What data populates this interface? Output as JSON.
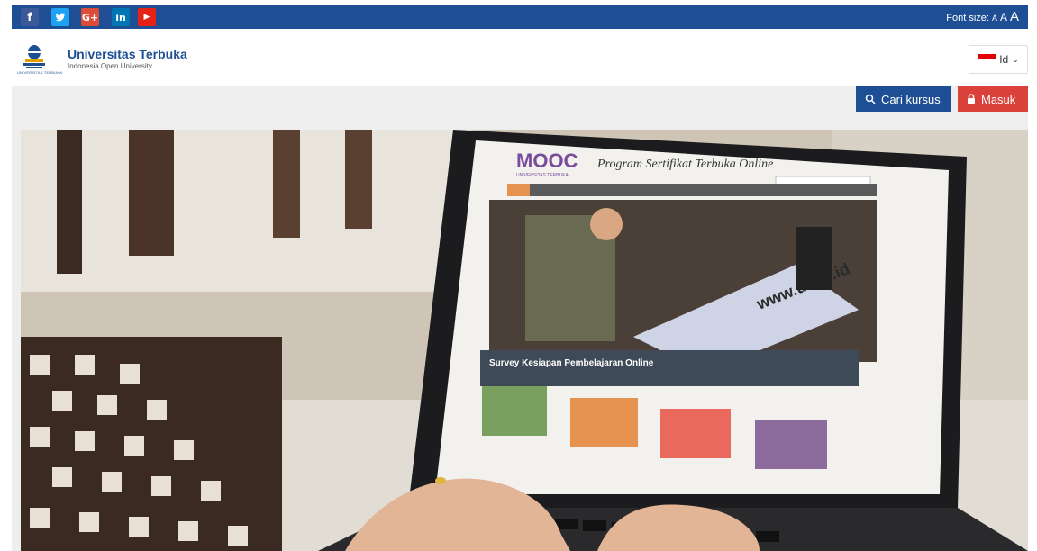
{
  "social": [
    {
      "name": "facebook",
      "glyph": "f",
      "color": "#3b5998"
    },
    {
      "name": "twitter",
      "glyph": "t",
      "color": "#1da1f2"
    },
    {
      "name": "google-plus",
      "glyph": "G+",
      "color": "#dd4b39"
    },
    {
      "name": "linkedin",
      "glyph": "in",
      "color": "#0077b5"
    },
    {
      "name": "youtube",
      "glyph": "▶",
      "color": "#e62117"
    }
  ],
  "fontsize": {
    "label": "Font size:",
    "small": "A",
    "medium": "A",
    "large": "A"
  },
  "brand": {
    "title": "Universitas Terbuka",
    "subtitle": "Indonesia Open University",
    "logo_caption": "UNIVERSITAS TERBUKA"
  },
  "language": {
    "code": "Id",
    "flag": "indonesia-flag"
  },
  "actions": {
    "search_label": "Cari kursus",
    "login_label": "Masuk"
  },
  "hero": {
    "mooc_logo": "MOOC",
    "mooc_logo_sub": "UNIVERSITAS TERBUKA",
    "site_title": "Program Sertifikat Terbuka Online",
    "screen_headline": "Survey Kesiapan Pembelajaran Online",
    "screen_url": "www.ut.ac.id",
    "tile_colors": [
      "#7aa060",
      "#e6924f",
      "#e96a5d",
      "#8c6c9c"
    ]
  },
  "colors": {
    "primary": "#1e4f95",
    "danger": "#d9413a",
    "bar_bg": "#eeeeee"
  }
}
